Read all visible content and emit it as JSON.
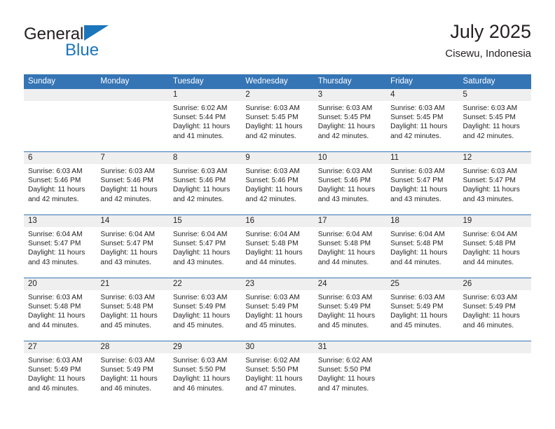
{
  "logo": {
    "word1": "General",
    "word2": "Blue",
    "triangle_color": "#1b75bb"
  },
  "header": {
    "title": "July 2025",
    "location": "Cisewu, Indonesia"
  },
  "theme": {
    "header_blue": "#3575b5",
    "daynum_band": "#efefef",
    "text": "#231f20"
  },
  "calendar": {
    "weekday_headers": [
      "Sunday",
      "Monday",
      "Tuesday",
      "Wednesday",
      "Thursday",
      "Friday",
      "Saturday"
    ],
    "labels": {
      "sunrise": "Sunrise:",
      "sunset": "Sunset:",
      "daylight": "Daylight:"
    },
    "weeks": [
      [
        {
          "day": "",
          "blank": true
        },
        {
          "day": "",
          "blank": true
        },
        {
          "day": "1",
          "sunrise": "Sunrise: 6:02 AM",
          "sunset": "Sunset: 5:44 PM",
          "daylight_l1": "Daylight: 11 hours",
          "daylight_l2": "and 41 minutes."
        },
        {
          "day": "2",
          "sunrise": "Sunrise: 6:03 AM",
          "sunset": "Sunset: 5:45 PM",
          "daylight_l1": "Daylight: 11 hours",
          "daylight_l2": "and 42 minutes."
        },
        {
          "day": "3",
          "sunrise": "Sunrise: 6:03 AM",
          "sunset": "Sunset: 5:45 PM",
          "daylight_l1": "Daylight: 11 hours",
          "daylight_l2": "and 42 minutes."
        },
        {
          "day": "4",
          "sunrise": "Sunrise: 6:03 AM",
          "sunset": "Sunset: 5:45 PM",
          "daylight_l1": "Daylight: 11 hours",
          "daylight_l2": "and 42 minutes."
        },
        {
          "day": "5",
          "sunrise": "Sunrise: 6:03 AM",
          "sunset": "Sunset: 5:45 PM",
          "daylight_l1": "Daylight: 11 hours",
          "daylight_l2": "and 42 minutes."
        }
      ],
      [
        {
          "day": "6",
          "sunrise": "Sunrise: 6:03 AM",
          "sunset": "Sunset: 5:46 PM",
          "daylight_l1": "Daylight: 11 hours",
          "daylight_l2": "and 42 minutes."
        },
        {
          "day": "7",
          "sunrise": "Sunrise: 6:03 AM",
          "sunset": "Sunset: 5:46 PM",
          "daylight_l1": "Daylight: 11 hours",
          "daylight_l2": "and 42 minutes."
        },
        {
          "day": "8",
          "sunrise": "Sunrise: 6:03 AM",
          "sunset": "Sunset: 5:46 PM",
          "daylight_l1": "Daylight: 11 hours",
          "daylight_l2": "and 42 minutes."
        },
        {
          "day": "9",
          "sunrise": "Sunrise: 6:03 AM",
          "sunset": "Sunset: 5:46 PM",
          "daylight_l1": "Daylight: 11 hours",
          "daylight_l2": "and 42 minutes."
        },
        {
          "day": "10",
          "sunrise": "Sunrise: 6:03 AM",
          "sunset": "Sunset: 5:46 PM",
          "daylight_l1": "Daylight: 11 hours",
          "daylight_l2": "and 43 minutes."
        },
        {
          "day": "11",
          "sunrise": "Sunrise: 6:03 AM",
          "sunset": "Sunset: 5:47 PM",
          "daylight_l1": "Daylight: 11 hours",
          "daylight_l2": "and 43 minutes."
        },
        {
          "day": "12",
          "sunrise": "Sunrise: 6:03 AM",
          "sunset": "Sunset: 5:47 PM",
          "daylight_l1": "Daylight: 11 hours",
          "daylight_l2": "and 43 minutes."
        }
      ],
      [
        {
          "day": "13",
          "sunrise": "Sunrise: 6:04 AM",
          "sunset": "Sunset: 5:47 PM",
          "daylight_l1": "Daylight: 11 hours",
          "daylight_l2": "and 43 minutes."
        },
        {
          "day": "14",
          "sunrise": "Sunrise: 6:04 AM",
          "sunset": "Sunset: 5:47 PM",
          "daylight_l1": "Daylight: 11 hours",
          "daylight_l2": "and 43 minutes."
        },
        {
          "day": "15",
          "sunrise": "Sunrise: 6:04 AM",
          "sunset": "Sunset: 5:47 PM",
          "daylight_l1": "Daylight: 11 hours",
          "daylight_l2": "and 43 minutes."
        },
        {
          "day": "16",
          "sunrise": "Sunrise: 6:04 AM",
          "sunset": "Sunset: 5:48 PM",
          "daylight_l1": "Daylight: 11 hours",
          "daylight_l2": "and 44 minutes."
        },
        {
          "day": "17",
          "sunrise": "Sunrise: 6:04 AM",
          "sunset": "Sunset: 5:48 PM",
          "daylight_l1": "Daylight: 11 hours",
          "daylight_l2": "and 44 minutes."
        },
        {
          "day": "18",
          "sunrise": "Sunrise: 6:04 AM",
          "sunset": "Sunset: 5:48 PM",
          "daylight_l1": "Daylight: 11 hours",
          "daylight_l2": "and 44 minutes."
        },
        {
          "day": "19",
          "sunrise": "Sunrise: 6:04 AM",
          "sunset": "Sunset: 5:48 PM",
          "daylight_l1": "Daylight: 11 hours",
          "daylight_l2": "and 44 minutes."
        }
      ],
      [
        {
          "day": "20",
          "sunrise": "Sunrise: 6:03 AM",
          "sunset": "Sunset: 5:48 PM",
          "daylight_l1": "Daylight: 11 hours",
          "daylight_l2": "and 44 minutes."
        },
        {
          "day": "21",
          "sunrise": "Sunrise: 6:03 AM",
          "sunset": "Sunset: 5:48 PM",
          "daylight_l1": "Daylight: 11 hours",
          "daylight_l2": "and 45 minutes."
        },
        {
          "day": "22",
          "sunrise": "Sunrise: 6:03 AM",
          "sunset": "Sunset: 5:49 PM",
          "daylight_l1": "Daylight: 11 hours",
          "daylight_l2": "and 45 minutes."
        },
        {
          "day": "23",
          "sunrise": "Sunrise: 6:03 AM",
          "sunset": "Sunset: 5:49 PM",
          "daylight_l1": "Daylight: 11 hours",
          "daylight_l2": "and 45 minutes."
        },
        {
          "day": "24",
          "sunrise": "Sunrise: 6:03 AM",
          "sunset": "Sunset: 5:49 PM",
          "daylight_l1": "Daylight: 11 hours",
          "daylight_l2": "and 45 minutes."
        },
        {
          "day": "25",
          "sunrise": "Sunrise: 6:03 AM",
          "sunset": "Sunset: 5:49 PM",
          "daylight_l1": "Daylight: 11 hours",
          "daylight_l2": "and 45 minutes."
        },
        {
          "day": "26",
          "sunrise": "Sunrise: 6:03 AM",
          "sunset": "Sunset: 5:49 PM",
          "daylight_l1": "Daylight: 11 hours",
          "daylight_l2": "and 46 minutes."
        }
      ],
      [
        {
          "day": "27",
          "sunrise": "Sunrise: 6:03 AM",
          "sunset": "Sunset: 5:49 PM",
          "daylight_l1": "Daylight: 11 hours",
          "daylight_l2": "and 46 minutes."
        },
        {
          "day": "28",
          "sunrise": "Sunrise: 6:03 AM",
          "sunset": "Sunset: 5:49 PM",
          "daylight_l1": "Daylight: 11 hours",
          "daylight_l2": "and 46 minutes."
        },
        {
          "day": "29",
          "sunrise": "Sunrise: 6:03 AM",
          "sunset": "Sunset: 5:50 PM",
          "daylight_l1": "Daylight: 11 hours",
          "daylight_l2": "and 46 minutes."
        },
        {
          "day": "30",
          "sunrise": "Sunrise: 6:02 AM",
          "sunset": "Sunset: 5:50 PM",
          "daylight_l1": "Daylight: 11 hours",
          "daylight_l2": "and 47 minutes."
        },
        {
          "day": "31",
          "sunrise": "Sunrise: 6:02 AM",
          "sunset": "Sunset: 5:50 PM",
          "daylight_l1": "Daylight: 11 hours",
          "daylight_l2": "and 47 minutes."
        },
        {
          "day": "",
          "blank": true
        },
        {
          "day": "",
          "blank": true
        }
      ]
    ]
  }
}
